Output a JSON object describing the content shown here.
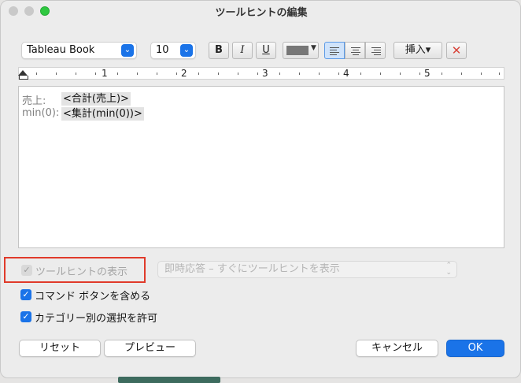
{
  "window": {
    "title": "ツールヒントの編集"
  },
  "toolbar": {
    "font_family": "Tableau Book",
    "font_size": "10",
    "bold": "B",
    "italic": "I",
    "underline": "U",
    "text_color": "#777777",
    "insert_label": "挿入▾",
    "clear_icon": "✕"
  },
  "ruler": {
    "marks": [
      "1",
      "2",
      "3",
      "4",
      "5"
    ]
  },
  "editor": {
    "lines": [
      {
        "label": "売上:",
        "field": "<合計(売上)>"
      },
      {
        "label": "min(0):",
        "field": "<集計(min(0))>"
      }
    ]
  },
  "options": {
    "show_tooltips": {
      "label": "ツールヒントの表示",
      "checked": true,
      "enabled": false
    },
    "behavior_select": "即時応答 – すぐにツールヒントを表示",
    "include_command_buttons": {
      "label": "コマンド ボタンを含める",
      "checked": true
    },
    "allow_category_select": {
      "label": "カテゴリー別の選択を許可",
      "checked": true
    }
  },
  "buttons": {
    "reset": "リセット",
    "preview": "プレビュー",
    "cancel": "キャンセル",
    "ok": "OK"
  },
  "colors": {
    "accent": "#1a73e8",
    "highlight_border": "#e03a2a"
  }
}
